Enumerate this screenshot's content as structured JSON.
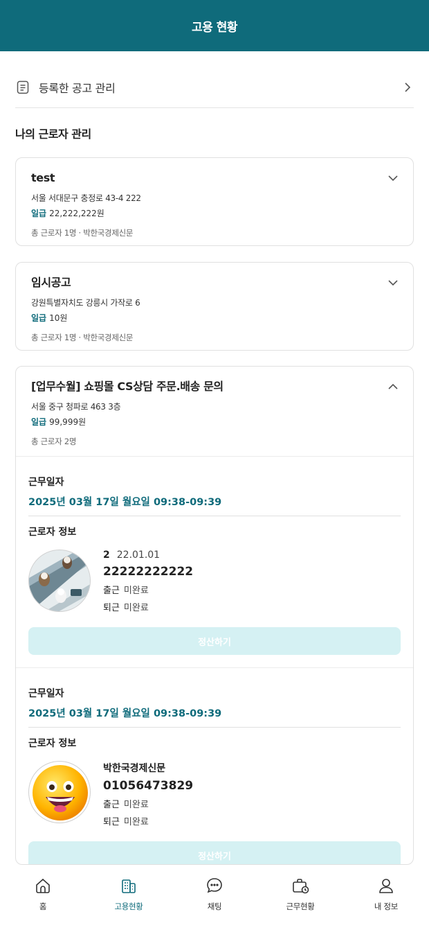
{
  "header": {
    "title": "고용 현황"
  },
  "managed_link": {
    "label": "등록한 공고 관리",
    "icon": "document-icon"
  },
  "section_title": "나의 근로자 관리",
  "jobs": [
    {
      "title": "test",
      "address": "서울 서대문구 충정로 43-4 222",
      "wage_label": "일급",
      "wage": "22,222,222원",
      "summary": "총 근로자 1명 · 박한국경제신문",
      "expanded": false
    },
    {
      "title": "임시공고",
      "address": "강원특별자치도 강릉시 가작로 6",
      "wage_label": "일급",
      "wage": "10원",
      "summary": "총 근로자 1명 · 박한국경제신문",
      "expanded": false
    },
    {
      "title": "[업무수월] 쇼핑몰 CS상담 주문.배송 문의",
      "address": "서울 중구 청파로 463 3층",
      "wage_label": "일급",
      "wage": "99,999원",
      "summary": "총 근로자 2명",
      "expanded": true
    }
  ],
  "work_blocks": [
    {
      "date_label": "근무일자",
      "date": "2025년 03월 17일 월요일 09:38-09:39",
      "worker_label": "근로자 정보",
      "name": "2",
      "dob": "22.01.01",
      "phone": "22222222222",
      "checkin_label": "출근",
      "checkin": "미완료",
      "checkout_label": "퇴근",
      "checkout": "미완료",
      "button": "정산하기"
    },
    {
      "date_label": "근무일자",
      "date": "2025년 03월 17일 월요일 09:38-09:39",
      "worker_label": "근로자 정보",
      "name": "박한국경제신문",
      "phone": "01056473829",
      "checkin_label": "출근",
      "checkin": "미완료",
      "checkout_label": "퇴근",
      "checkout": "미완료",
      "button": "정산하기"
    }
  ],
  "tabs": [
    {
      "label": "홈",
      "icon": "home-icon"
    },
    {
      "label": "고용현황",
      "icon": "employment-icon",
      "active": true
    },
    {
      "label": "채팅",
      "icon": "chat-icon"
    },
    {
      "label": "근무현황",
      "icon": "work-status-icon"
    },
    {
      "label": "내 정보",
      "icon": "profile-icon"
    }
  ],
  "colors": {
    "brand": "#0f6b7b",
    "button_disabled": "#d5f1f3"
  }
}
